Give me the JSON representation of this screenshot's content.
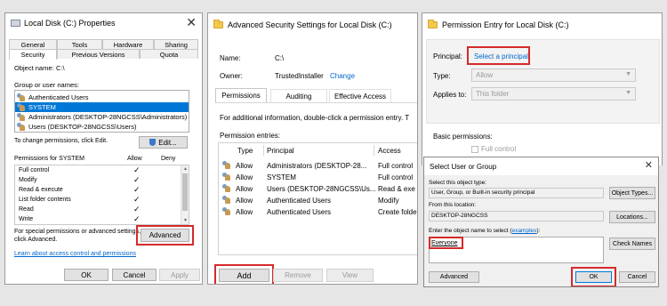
{
  "colors": {
    "highlight": "#d42a2a",
    "selection": "#0078d7",
    "link": "#0066cc"
  },
  "w1": {
    "title": "Local Disk (C:) Properties",
    "close": "✕",
    "tabs_top": [
      "General",
      "Tools",
      "Hardware",
      "Sharing"
    ],
    "tabs_bottom": [
      "Security",
      "Previous Versions",
      "Quota"
    ],
    "object_label": "Object name:",
    "object_value": "C:\\",
    "group_label": "Group or user names:",
    "groups": [
      "Authenticated Users",
      "SYSTEM",
      "Administrators (DESKTOP-28NGCSS\\Administrators)",
      "Users (DESKTOP-28NGCSS\\Users)"
    ],
    "change_text": "To change permissions, click Edit.",
    "edit_label": "Edit...",
    "perm_header": "Permissions for SYSTEM",
    "allow_label": "Allow",
    "deny_label": "Deny",
    "perms": [
      "Full control",
      "Modify",
      "Read & execute",
      "List folder contents",
      "Read",
      "Write"
    ],
    "check": "✓",
    "special_text1": "For special permissions or advanced settings,",
    "special_text2": "click Advanced.",
    "advanced_label": "Advanced",
    "learn_link": "Learn about access control and permissions",
    "ok_label": "OK",
    "cancel_label": "Cancel",
    "apply_label": "Apply"
  },
  "w2": {
    "title": "Advanced Security Settings for Local Disk (C:)",
    "name_label": "Name:",
    "name_value": "C:\\",
    "owner_label": "Owner:",
    "owner_value": "TrustedInstaller",
    "change_link": "Change",
    "tabs": [
      "Permissions",
      "Auditing",
      "Effective Access"
    ],
    "info_text": "For additional information, double-click a permission entry. T",
    "entries_label": "Permission entries:",
    "col_type": "Type",
    "col_principal": "Principal",
    "col_access": "Access",
    "entries": [
      {
        "type": "Allow",
        "principal": "Administrators (DESKTOP-28...",
        "access": "Full control"
      },
      {
        "type": "Allow",
        "principal": "SYSTEM",
        "access": "Full control"
      },
      {
        "type": "Allow",
        "principal": "Users (DESKTOP-28NGCSS\\Us...",
        "access": "Read & exe"
      },
      {
        "type": "Allow",
        "principal": "Authenticated Users",
        "access": "Modify"
      },
      {
        "type": "Allow",
        "principal": "Authenticated Users",
        "access": "Create folde"
      }
    ],
    "add_label": "Add",
    "remove_label": "Remove",
    "view_label": "View"
  },
  "w3": {
    "title": "Permission Entry for Local Disk (C:)",
    "principal_label": "Principal:",
    "principal_link": "Select a principal",
    "type_label": "Type:",
    "type_value": "Allow",
    "applies_label": "Applies to:",
    "applies_value": "This folder",
    "basic_label": "Basic permissions:",
    "full_control": "Full control"
  },
  "w4": {
    "title": "Select User or Group",
    "close": "✕",
    "objtype_label": "Select this object type:",
    "objtype_value": "User, Group, or Built-in security principal",
    "object_types_btn": "Object Types...",
    "location_label": "From this location:",
    "location_value": "DESKTOP-28NGCSS",
    "locations_btn": "Locations...",
    "enter_label_prefix": "Enter the object name to select (",
    "enter_label_link": "examples",
    "enter_label_suffix": "):",
    "name_value": "Everyone",
    "check_names_btn": "Check Names",
    "advanced_btn": "Advanced",
    "ok_btn": "OK",
    "cancel_btn": "Cancel"
  }
}
